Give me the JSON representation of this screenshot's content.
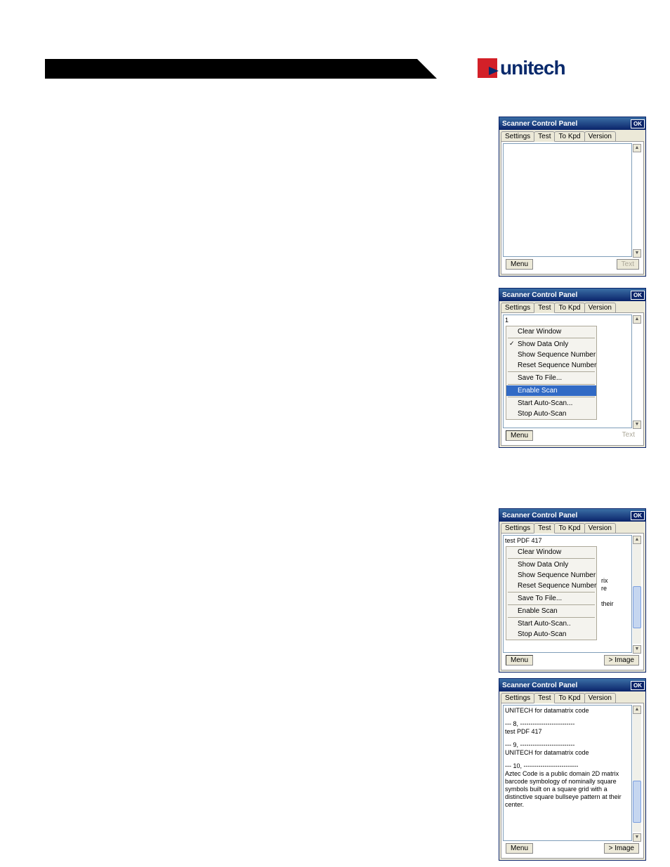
{
  "brand": "unitech",
  "window_title": "Scanner Control Panel",
  "ok_label": "OK",
  "tabs": {
    "settings": "Settings",
    "test": "Test",
    "tokpd": "To Kpd",
    "version": "Version"
  },
  "menu_label": "Menu",
  "text_label": "Text",
  "image_label": "> Image",
  "menu_items": {
    "clear_window": "Clear Window",
    "show_data_only": "Show Data Only",
    "show_seq_num": "Show Sequence Number",
    "reset_seq_num": "Reset Sequence Number",
    "save_to_file": "Save To File...",
    "enable_scan": "Enable Scan",
    "start_auto": "Start Auto-Scan...",
    "start_auto_short": "Start Auto-Scan..",
    "stop_auto": "Stop Auto-Scan"
  },
  "win2_pane_prefix": "1",
  "side_text": {
    "rix": "rix",
    "re": "re",
    "their": "their"
  },
  "win3_first_line": "test PDF 417",
  "win4_content": {
    "l1": "UNITECH for datamatrix code",
    "l2a": "--- 8, --------------------------",
    "l2b": "test PDF 417",
    "l3a": "--- 9, --------------------------",
    "l3b": "UNITECH for datamatrix code",
    "l4a": "--- 10, --------------------------",
    "l4b": "Aztec Code is a public domain 2D matrix barcode symbology of nominally square symbols built on a square grid with a distinctive square bullseye pattern at their center."
  }
}
